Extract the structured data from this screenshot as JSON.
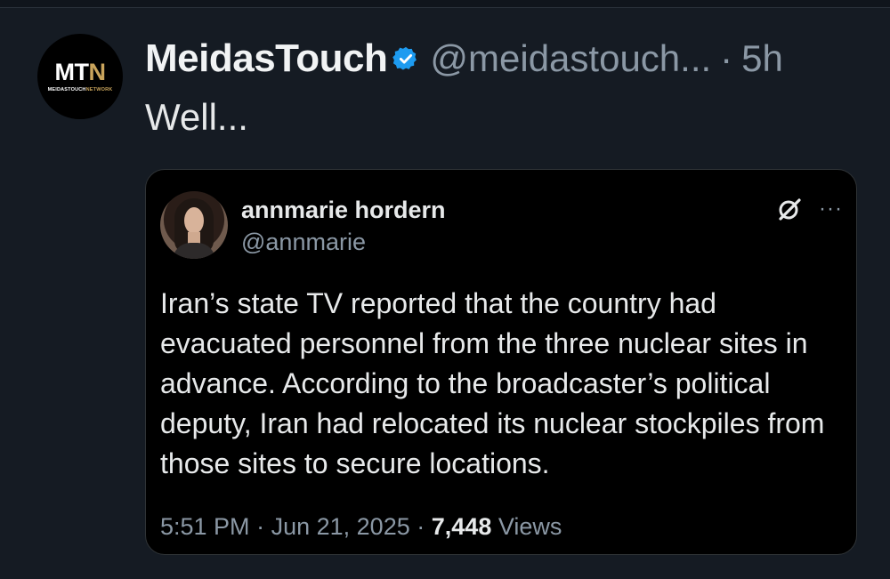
{
  "post": {
    "avatar_text": "MTN",
    "avatar_subtext": "MEIDASTOUCHNETWORK",
    "display_name": "MeidasTouch",
    "handle": "@meidastouch...",
    "separator": "·",
    "time": "5h",
    "text": "Well..."
  },
  "quote": {
    "name": "annmarie hordern",
    "handle": "@annmarie",
    "more_label": "···",
    "text": "Iran’s state TV reported that the country had evacuated personnel from the three nuclear sites in advance. According to the broadcaster’s political deputy, Iran had relocated its nuclear stockpiles from those sites to secure locations.",
    "time": "5:51 PM",
    "separator": "·",
    "date": "Jun 21, 2025",
    "separator2": "·",
    "views_count": "7,448",
    "views_label": "Views"
  },
  "colors": {
    "background": "#151b23",
    "verified_blue": "#1d9bf0",
    "muted": "#8b98a5",
    "brand_gold": "#c9a45c"
  },
  "icons": {
    "verified": "verified-badge-icon",
    "grok": "grok-icon",
    "more": "more-icon"
  }
}
